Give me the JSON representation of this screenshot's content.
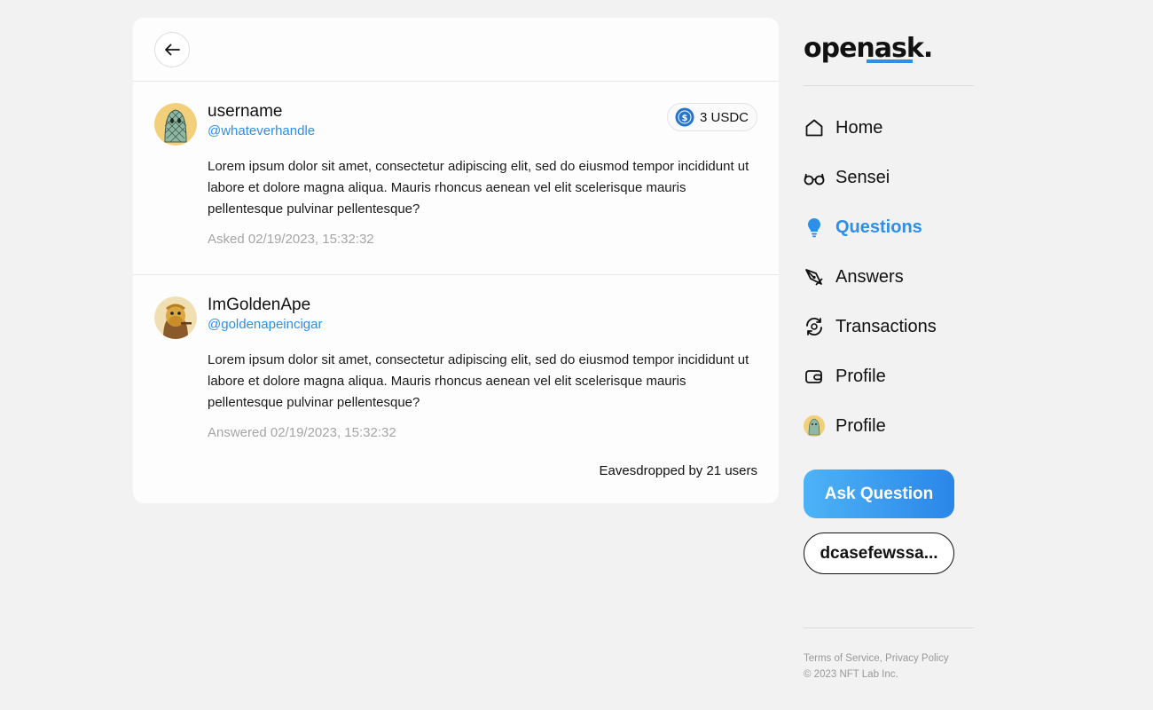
{
  "question": {
    "author_name": "username",
    "author_handle": "@whateverhandle",
    "reward": "3 USDC",
    "body": "Lorem ipsum dolor sit amet, consectetur adipiscing elit, sed do eiusmod tempor incididunt ut labore et dolore magna aliqua. Mauris rhoncus aenean vel elit scelerisque mauris pellentesque pulvinar pellentesque?",
    "timestamp": "Asked 02/19/2023, 15:32:32"
  },
  "answer": {
    "author_name": "ImGoldenApe",
    "author_handle": "@goldenapeincigar",
    "body": "Lorem ipsum dolor sit amet, consectetur adipiscing elit, sed do eiusmod tempor incididunt ut labore et dolore magna aliqua. Mauris rhoncus aenean vel elit scelerisque mauris pellentesque pulvinar pellentesque?",
    "timestamp": "Answered 02/19/2023, 15:32:32",
    "eavesdropped": "Eavesdropped by 21 users"
  },
  "sidebar": {
    "logo": "openask.",
    "nav": [
      {
        "label": "Home",
        "icon": "home-icon"
      },
      {
        "label": "Sensei",
        "icon": "glasses-icon"
      },
      {
        "label": "Questions",
        "icon": "lightbulb-icon",
        "active": true
      },
      {
        "label": "Answers",
        "icon": "pen-nib-icon"
      },
      {
        "label": "Transactions",
        "icon": "exchange-icon"
      },
      {
        "label": "Profile",
        "icon": "wallet-icon"
      },
      {
        "label": "Profile",
        "icon": "avatar-icon"
      }
    ],
    "ask_button": "Ask Question",
    "wallet_button": "dcasefewssa...",
    "footer": {
      "terms": "Terms of Service",
      "separator": ", ",
      "privacy": "Privacy Policy",
      "copyright": "© 2023 NFT Lab Inc."
    }
  },
  "colors": {
    "accent": "#2d8fe6",
    "background": "#f2f2f2",
    "usdc": "#2775ca"
  }
}
